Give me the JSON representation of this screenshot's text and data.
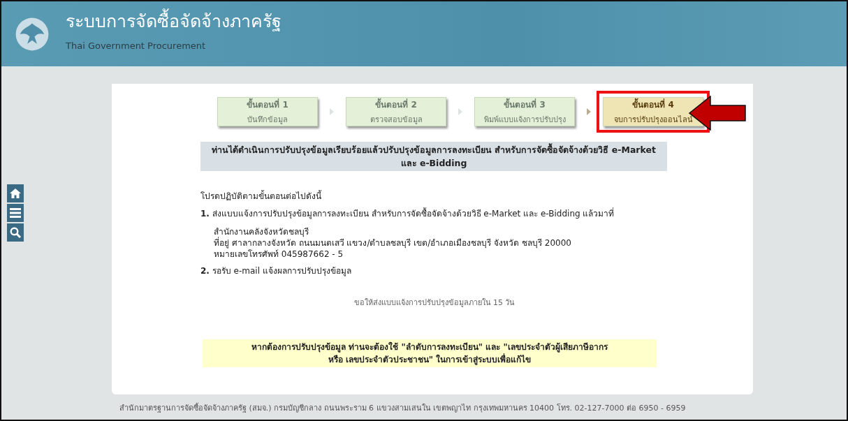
{
  "header": {
    "title": "ระบบการจัดซื้อจัดจ้างภาครัฐ",
    "subtitle": "Thai Government Procurement"
  },
  "side_buttons": [
    {
      "kind": "home"
    },
    {
      "kind": "menu"
    },
    {
      "kind": "search"
    }
  ],
  "steps": [
    {
      "title": "ขั้นตอนที่ 1",
      "label": "บันทึกข้อมูล",
      "selected": false
    },
    {
      "title": "ขั้นตอนที่ 2",
      "label": "ตรวจสอบข้อมูล",
      "selected": false
    },
    {
      "title": "ขั้นตอนที่ 3",
      "label": "พิมพ์แบบแจ้งการปรับปรุง",
      "selected": false
    },
    {
      "title": "ขั้นตอนที่ 4",
      "label": "จบการปรับปรุงออนไลน์",
      "selected": true
    }
  ],
  "heading": "ท่านได้ดำเนินการปรับปรุงข้อมูลเรียบร้อยแล้วปรับปรุงข้อมูลการลงทะเบียน สำหรับการจัดซื้อจัดจ้างด้วยวิธี e-Market และ e-Bidding",
  "intro": "โปรดปฏิบัติตามขั้นตอนต่อไปดังนี้",
  "instructions": [
    {
      "number": "1.",
      "text": "ส่งแบบแจ้งการปรับปรุงข้อมูลการลงทะเบียน สำหรับการจัดซื้อจัดจ้างด้วยวิธี e-Market และ e-Bidding แล้วมาที่",
      "address": [
        "สำนักงานคลังจังหวัดชลบุรี",
        "ที่อยู่ ศาลากลางจังหวัด ถนนมนตเสวี แขวง/ตำบลชลบุรี เขต/อำเภอเมืองชลบุรี จังหวัด ชลบุรี 20000",
        "หมายเลขโทรศัพท์ 045987662 - 5"
      ]
    },
    {
      "number": "2.",
      "text": "รอรับ e-mail แจ้งผลการปรับปรุงข้อมูล"
    }
  ],
  "deadline_note": "ขอให้ส่งแบบแจ้งการปรับปรุงข้อมูลภายใน 15 วัน",
  "notice": "หากต้องการปรับปรุงข้อมูล ท่านจะต้องใช้ \"ลำดับการลงทะเบียน\" และ \"เลขประจำตัวผู้เสียภาษีอากรหรือ เลขประจำตัวประชาชน\" ในการเข้าสู่ระบบเพื่อแก้ไข",
  "footer": "สำนักมาตรฐานการจัดซื้อจัดจ้างภาครัฐ (สมจ.) กรมบัญชีกลาง ถนนพระราม 6 แขวงสามเสนใน เขตพญาไท กรุงเทพมหานคร 10400 โทร. 02-127-7000 ต่อ 6950 - 6959"
}
